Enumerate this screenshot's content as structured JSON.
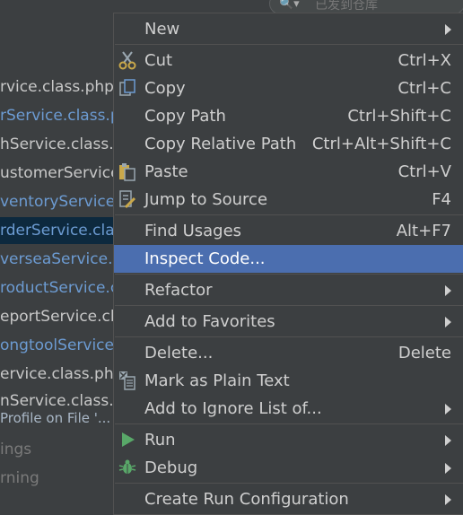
{
  "search": {
    "text": "已发到仓库"
  },
  "tree": {
    "files": [
      {
        "name": "rvice.class.php"
      },
      {
        "name": "rService.class.p"
      },
      {
        "name": "hService.class.p"
      },
      {
        "name": "ustomerService"
      },
      {
        "name": "ventoryService"
      },
      {
        "name": "rderService.clas"
      },
      {
        "name": "verseaService.c"
      },
      {
        "name": "roductService.c"
      },
      {
        "name": "eportService.cla"
      },
      {
        "name": "ongtoolService."
      },
      {
        "name": "ervice.class.php"
      },
      {
        "name": "nService.class.p"
      },
      {
        "name": "Profile on File '..."
      },
      {
        "name": "ings"
      },
      {
        "name": "rning"
      }
    ]
  },
  "menu": {
    "new": {
      "label": "New"
    },
    "cut": {
      "label": "Cut",
      "shortcut": "Ctrl+X"
    },
    "copy": {
      "label": "Copy",
      "shortcut": "Ctrl+C"
    },
    "copy_path": {
      "label": "Copy Path",
      "shortcut": "Ctrl+Shift+C"
    },
    "copy_relative_path": {
      "label": "Copy Relative Path",
      "shortcut": "Ctrl+Alt+Shift+C"
    },
    "paste": {
      "label": "Paste",
      "shortcut": "Ctrl+V"
    },
    "jump_to_source": {
      "label": "Jump to Source",
      "shortcut": "F4"
    },
    "find_usages": {
      "label": "Find Usages",
      "shortcut": "Alt+F7"
    },
    "inspect_code": {
      "label": "Inspect Code..."
    },
    "refactor": {
      "label": "Refactor"
    },
    "add_to_favorites": {
      "label": "Add to Favorites"
    },
    "delete": {
      "label": "Delete...",
      "shortcut": "Delete"
    },
    "mark_plain_text": {
      "label": "Mark as Plain Text"
    },
    "add_to_ignore": {
      "label": "Add to Ignore List of..."
    },
    "run": {
      "label": "Run"
    },
    "debug": {
      "label": "Debug"
    },
    "create_run_config": {
      "label": "Create Run Configuration"
    }
  },
  "colors": {
    "menu_bg": "#3c3f41",
    "highlight": "#4b6eaf",
    "selected_row": "#0d293e",
    "link_blue": "#6c9bd2",
    "run_green": "#59a869"
  }
}
